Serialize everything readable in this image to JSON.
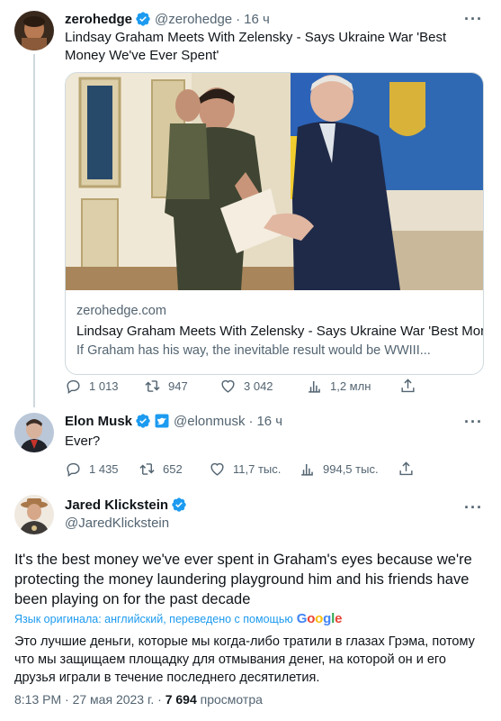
{
  "tweet1": {
    "name": "zerohedge",
    "handle": "@zerohedge",
    "time": "16 ч",
    "text": "Lindsay Graham Meets With Zelensky - Says Ukraine War 'Best Money We've Ever Spent'",
    "card": {
      "domain": "zerohedge.com",
      "title": "Lindsay Graham Meets With Zelensky - Says Ukraine War 'Best Mon...",
      "description": "If Graham has his way, the inevitable result would be WWIII..."
    },
    "actions": {
      "replies": "1 013",
      "retweets": "947",
      "likes": "3 042",
      "views": "1,2 млн"
    }
  },
  "tweet2": {
    "name": "Elon Musk",
    "handle": "@elonmusk",
    "time": "16 ч",
    "text": "Ever?",
    "actions": {
      "replies": "1 435",
      "retweets": "652",
      "likes": "11,7 тыс.",
      "views": "994,5 тыс."
    }
  },
  "tweet3": {
    "name": "Jared Klickstein",
    "handle": "@JaredKlickstein",
    "text": "It's the best money we've ever spent in Graham's eyes because we're protecting the money laundering playground him and his friends have been playing on for the past decade",
    "translate_note": "Язык оригинала: английский, переведено с помощью",
    "translate_brand": "Google",
    "translation": "Это лучшие деньги, которые мы когда-либо тратили в глазах Грэма, потому что мы защищаем площадку для отмывания денег, на которой он и его друзья играли в течение последнего десятилетия.",
    "time": "8:13 PM",
    "date": "27 мая 2023 г.",
    "views_count": "7 694",
    "views_label": "просмотра"
  },
  "colors": {
    "accent": "#1d9bf0",
    "verified": "#1d9bf0",
    "muted": "#536471",
    "border": "#cfd9de"
  },
  "icons": [
    "verified-badge-icon",
    "more-icon",
    "reply-icon",
    "retweet-icon",
    "like-icon",
    "views-icon",
    "share-icon",
    "government-badge-icon"
  ]
}
